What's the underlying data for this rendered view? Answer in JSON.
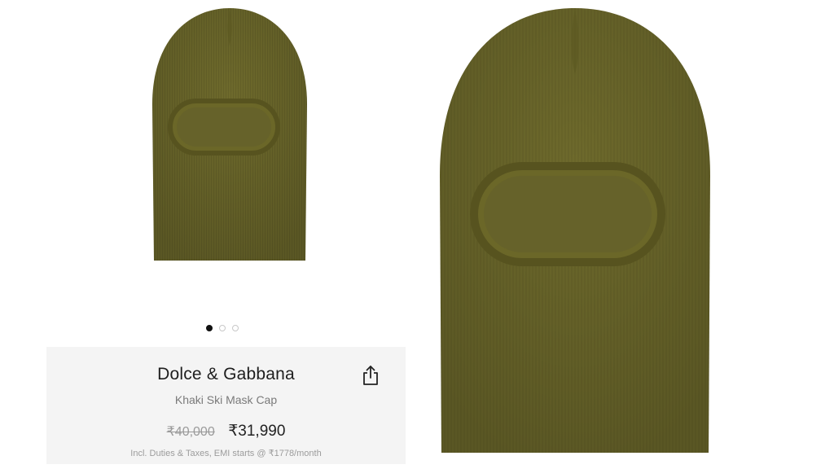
{
  "carousel": {
    "count": 3,
    "active_index": 0
  },
  "product": {
    "brand": "Dolce & Gabbana",
    "name": "Khaki Ski Mask Cap",
    "original_price": "₹40,000",
    "current_price": "₹31,990",
    "tax_note": "Incl. Duties & Taxes, EMI starts @ ₹1778/month"
  },
  "icons": {
    "share": "share-icon"
  },
  "colors": {
    "product_khaki": "#6e6a2c",
    "card_background": "#f4f4f4",
    "active_dot": "#111111"
  }
}
